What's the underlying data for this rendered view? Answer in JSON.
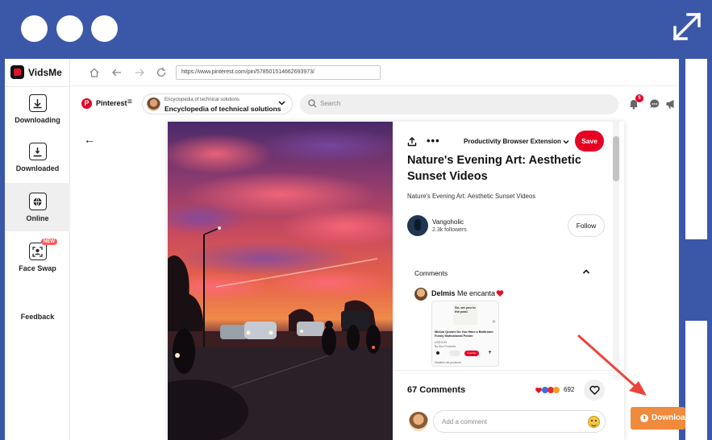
{
  "app": {
    "name": "VidsMe"
  },
  "sidebar": {
    "items": [
      {
        "label": "Downloading",
        "icon": "download-tray-icon"
      },
      {
        "label": "Downloaded",
        "icon": "downloaded-tray-icon"
      },
      {
        "label": "Online",
        "icon": "globe-icon",
        "active": true
      },
      {
        "label": "Face Swap",
        "icon": "face-scan-icon",
        "badge": "NEW"
      }
    ],
    "feedback": "Feedback"
  },
  "browser": {
    "url": "https://www.pinterest.com/pin/578501514662693973/"
  },
  "pinterest": {
    "brand": "Pinterest",
    "board_small": "Encyclopedia of technical solutions",
    "board_big": "Encyclopedia of technical solutions",
    "search_placeholder": "Search",
    "notification_count": "5"
  },
  "pin": {
    "extension_dropdown": "Productivity Browser Extension",
    "save_label": "Save",
    "title": "Nature's Evening Art: Aesthetic Sunset Videos",
    "description": "Nature's Evening Art: Aesthetic Sunset Videos",
    "author_name": "Vangoholic",
    "author_followers": "2.3k followers",
    "follow_label": "Follow",
    "comments_heading": "Comments",
    "comment": {
      "author": "Delmis",
      "text": "Me encanta",
      "embed": {
        "image_text": "So, we you to the pool.",
        "title": "Minion Quotes Do You Have a Bathroom Funny Motivational Poster",
        "line1": "USD 6.99",
        "line2": "By Sho Products",
        "button": "Guardar",
        "footer": "Detalles del producto"
      }
    },
    "comments_count": "67 Comments",
    "reaction_count": "692",
    "comment_placeholder": "Add a comment"
  },
  "download": {
    "label": "Download"
  },
  "colors": {
    "frame": "#3B57A8",
    "pinterest_red": "#E60023",
    "download_orange": "#F08A3C",
    "arrow_red": "#E8453C"
  }
}
